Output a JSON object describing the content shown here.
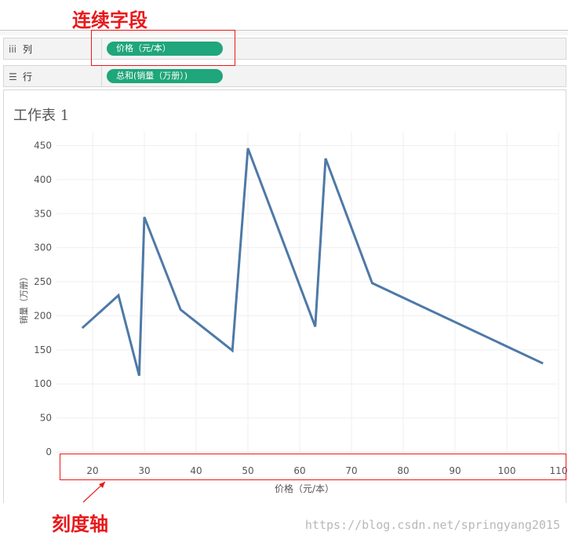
{
  "annotations": {
    "top_label": "连续字段",
    "bottom_label": "刻度轴",
    "color": "#e8191b"
  },
  "shelves": {
    "columns": {
      "icon": "columns-icon",
      "icon_glyph": "iii",
      "label": "列",
      "pill": "价格（元/本）"
    },
    "rows": {
      "icon": "rows-icon",
      "icon_glyph": "☰",
      "label": "行",
      "pill": "总和(销量（万册）)"
    },
    "pill_color": "#1fa67a"
  },
  "sheet": {
    "title": "工作表 1"
  },
  "watermark": "https://blog.csdn.net/springyang2015",
  "chart_data": {
    "type": "line",
    "xlabel": "价格（元/本）",
    "ylabel": "销量（万册）",
    "xlim": [
      13,
      113
    ],
    "ylim": [
      0,
      465
    ],
    "x_ticks": [
      20,
      30,
      40,
      50,
      60,
      70,
      80,
      90,
      100,
      110
    ],
    "y_ticks": [
      0,
      50,
      100,
      150,
      200,
      250,
      300,
      350,
      400,
      450
    ],
    "grid": true,
    "line_color": "#4e79a7",
    "series": [
      {
        "x": [
          18,
          25,
          29,
          30,
          37,
          47,
          50,
          63,
          65,
          74,
          107
        ],
        "y": [
          182,
          230,
          112,
          345,
          209,
          149,
          446,
          184,
          431,
          248,
          130
        ]
      }
    ]
  }
}
